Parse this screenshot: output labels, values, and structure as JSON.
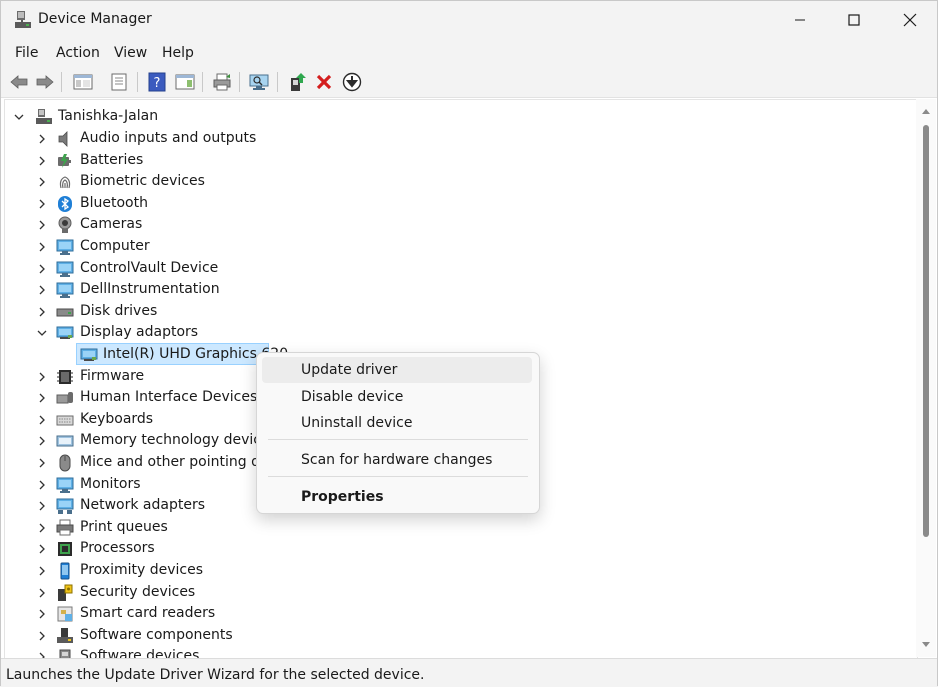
{
  "window": {
    "title": "Device Manager"
  },
  "menu": [
    "File",
    "Action",
    "View",
    "Help"
  ],
  "tree": {
    "root": "Tanishka-Jalan",
    "categories": [
      {
        "label": "Audio inputs and outputs",
        "icon": "speaker-icon"
      },
      {
        "label": "Batteries",
        "icon": "battery-icon"
      },
      {
        "label": "Biometric devices",
        "icon": "fingerprint-icon"
      },
      {
        "label": "Bluetooth",
        "icon": "bluetooth-icon"
      },
      {
        "label": "Cameras",
        "icon": "camera-icon"
      },
      {
        "label": "Computer",
        "icon": "computer-icon"
      },
      {
        "label": "ControlVault Device",
        "icon": "monitor-icon"
      },
      {
        "label": "DellInstrumentation",
        "icon": "monitor-icon"
      },
      {
        "label": "Disk drives",
        "icon": "disk-icon"
      },
      {
        "label": "Display adaptors",
        "icon": "display-adapter-icon",
        "expanded": true,
        "children": [
          {
            "label": "Intel(R) UHD Graphics 620",
            "icon": "display-adapter-icon"
          }
        ]
      },
      {
        "label": "Firmware",
        "icon": "chip-icon"
      },
      {
        "label": "Human Interface Devices",
        "icon": "hid-icon"
      },
      {
        "label": "Keyboards",
        "icon": "keyboard-icon"
      },
      {
        "label": "Memory technology devices",
        "icon": "memory-icon"
      },
      {
        "label": "Mice and other pointing devices",
        "icon": "mouse-icon"
      },
      {
        "label": "Monitors",
        "icon": "monitor-icon"
      },
      {
        "label": "Network adapters",
        "icon": "network-icon"
      },
      {
        "label": "Print queues",
        "icon": "printer-icon"
      },
      {
        "label": "Processors",
        "icon": "processor-icon"
      },
      {
        "label": "Proximity devices",
        "icon": "proximity-icon"
      },
      {
        "label": "Security devices",
        "icon": "security-icon"
      },
      {
        "label": "Smart card readers",
        "icon": "smart-card-icon"
      },
      {
        "label": "Software components",
        "icon": "software-component-icon"
      },
      {
        "label": "Software devices",
        "icon": "software-device-icon"
      }
    ]
  },
  "context_menu": {
    "items": [
      "Update driver",
      "Disable device",
      "Uninstall device",
      "Scan for hardware changes",
      "Properties"
    ]
  },
  "status": {
    "text": "Launches the Update Driver Wizard for the selected device."
  }
}
